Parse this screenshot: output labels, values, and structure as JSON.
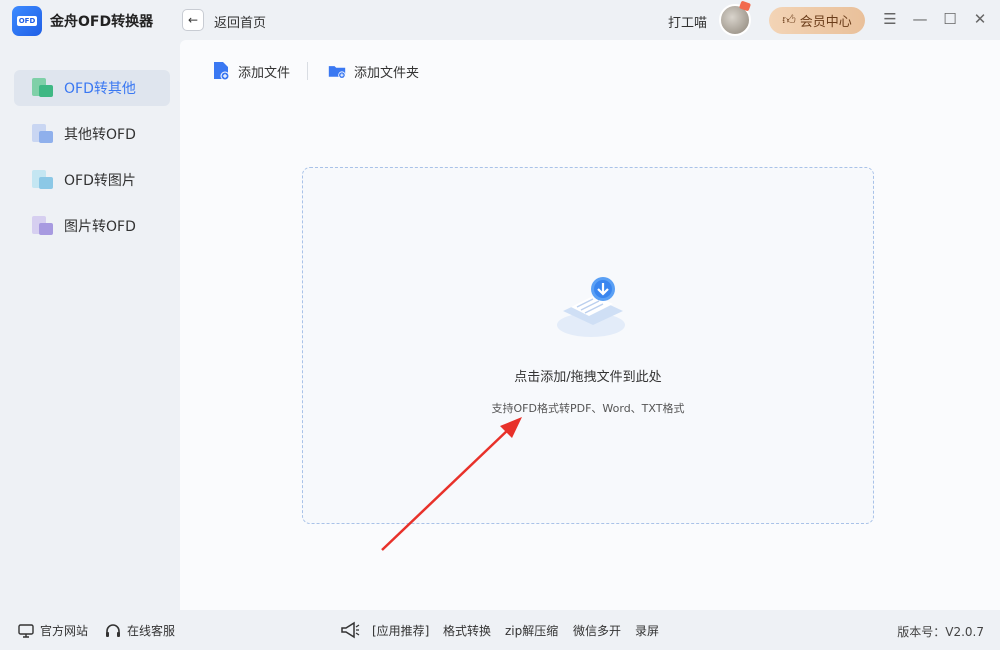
{
  "app": {
    "logo_text": "OFD",
    "title": "金舟OFD转换器"
  },
  "header": {
    "back_label": "返回首页",
    "user_name": "打工喵",
    "vip_label": "会员中心"
  },
  "window_controls": {
    "menu": "☰",
    "minimize": "—",
    "maximize": "☐",
    "close": "✕"
  },
  "sidebar": {
    "items": [
      {
        "label": "OFD转其他",
        "active": true
      },
      {
        "label": "其他转OFD",
        "active": false
      },
      {
        "label": "OFD转图片",
        "active": false
      },
      {
        "label": "图片转OFD",
        "active": false
      }
    ]
  },
  "toolbar": {
    "add_file": "添加文件",
    "add_folder": "添加文件夹"
  },
  "dropzone": {
    "title": "点击添加/拖拽文件到此处",
    "subtitle": "支持OFD格式转PDF、Word、TXT格式"
  },
  "footer": {
    "official_site": "官方网站",
    "online_service": "在线客服",
    "recommend_label": "[应用推荐]",
    "links": [
      "格式转换",
      "zip解压缩",
      "微信多开",
      "录屏"
    ],
    "version": "版本号：V2.0.7"
  },
  "colors": {
    "accent": "#3a78f2",
    "arrow": "#e8312a",
    "vip_bg": "#efcaa7"
  }
}
